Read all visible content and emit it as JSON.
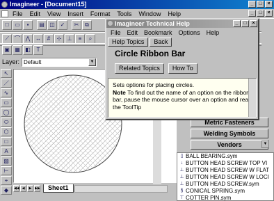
{
  "window": {
    "title": "Imagineer - [Document15]"
  },
  "menubar": {
    "items": [
      "File",
      "Edit",
      "View",
      "Insert",
      "Format",
      "Tools",
      "Window",
      "Help"
    ]
  },
  "layer": {
    "label": "Layer:",
    "value": "Default"
  },
  "help": {
    "title": "Imagineer Technical Help",
    "menu": [
      "File",
      "Edit",
      "Bookmark",
      "Options",
      "Help"
    ],
    "buttons": [
      "Help Topics",
      "Back"
    ],
    "heading": "Circle Ribbon Bar",
    "related_label": "Related Topics",
    "howto_label": "How To",
    "body_line1": "Sets options for placing circles.",
    "note_label": "Note",
    "note_text": "To find out the name of an option on the ribbon bar, pause the mouse cursor over an option and read the ToolTip"
  },
  "categories": [
    "Metric Fasteners",
    "Welding Symbols",
    "Vendors"
  ],
  "files": [
    "BALL BEARING.sym",
    "BUTTON HEAD SCREW TOP VI",
    "BUTTON HEAD SCREW W FLAT",
    "BUTTON HEAD SCREW W LOCI",
    "BUTTON HEAD SCREW.sym",
    "CONICAL SPRING.sym",
    "COTTER PIN.sym"
  ],
  "sheet": {
    "tab_label": "Sheet1"
  },
  "colors": {
    "titlebar": "#000080",
    "canvas": "#ffffff",
    "help_body": "#fffff0",
    "hatch": "#808080"
  }
}
